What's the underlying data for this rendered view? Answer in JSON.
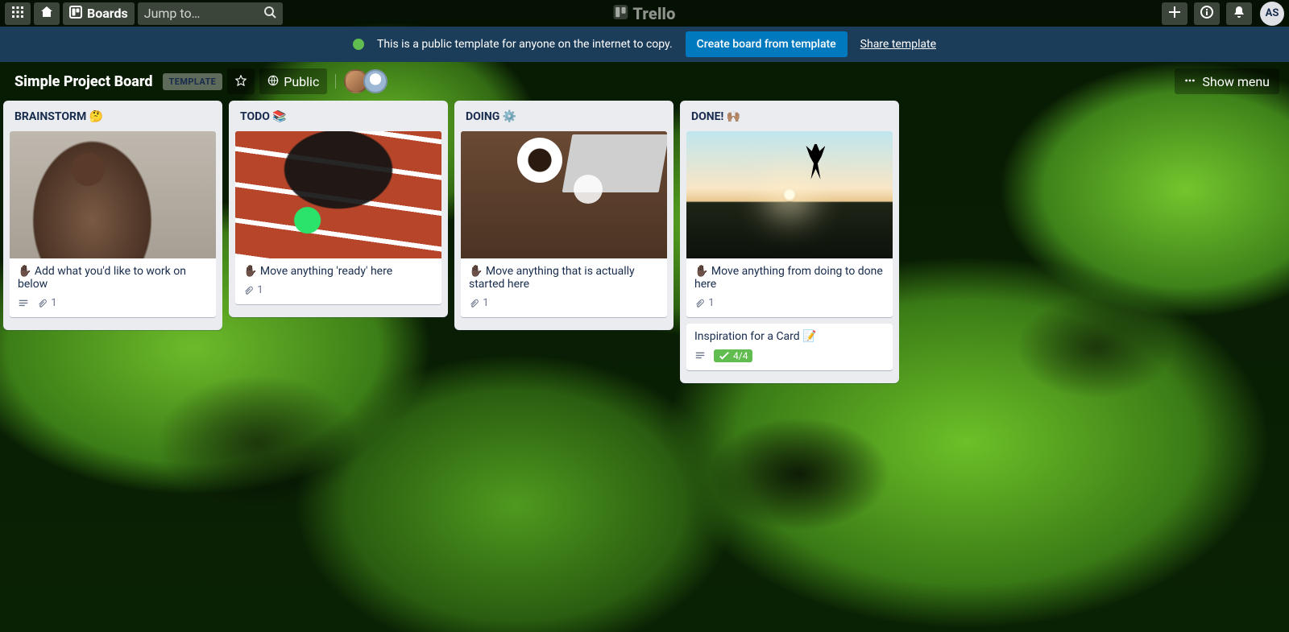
{
  "topnav": {
    "boards_label": "Boards",
    "jump_placeholder": "Jump to…",
    "brand": "Trello",
    "avatar_initials": "AS"
  },
  "banner": {
    "message": "This is a public template for anyone on the internet to copy.",
    "cta": "Create board from template",
    "share": "Share template"
  },
  "board_header": {
    "title": "Simple Project Board",
    "template_badge": "TEMPLATE",
    "visibility": "Public",
    "show_menu": "Show menu"
  },
  "lists": [
    {
      "title": "BRAINSTORM 🤔",
      "cards": [
        {
          "cover": "cover-brainstorm",
          "text": "✋🏿 Add what you'd like to work on below",
          "has_description": true,
          "attachments": "1"
        }
      ]
    },
    {
      "title": "TODO 📚",
      "cards": [
        {
          "cover": "cover-todo",
          "text": "✋🏿 Move anything 'ready' here",
          "has_description": false,
          "attachments": "1"
        }
      ]
    },
    {
      "title": "DOING ⚙️",
      "cards": [
        {
          "cover": "cover-doing",
          "text": "✋🏿 Move anything that is actually started here",
          "has_description": false,
          "attachments": "1"
        }
      ]
    },
    {
      "title": "DONE! 🙌🏽",
      "cards": [
        {
          "cover": "cover-done",
          "text": "✋🏿 Move anything from doing to done here",
          "has_description": false,
          "attachments": "1"
        },
        {
          "text": "Inspiration for a Card 📝",
          "has_description": true,
          "checklist": "4/4"
        }
      ]
    }
  ]
}
